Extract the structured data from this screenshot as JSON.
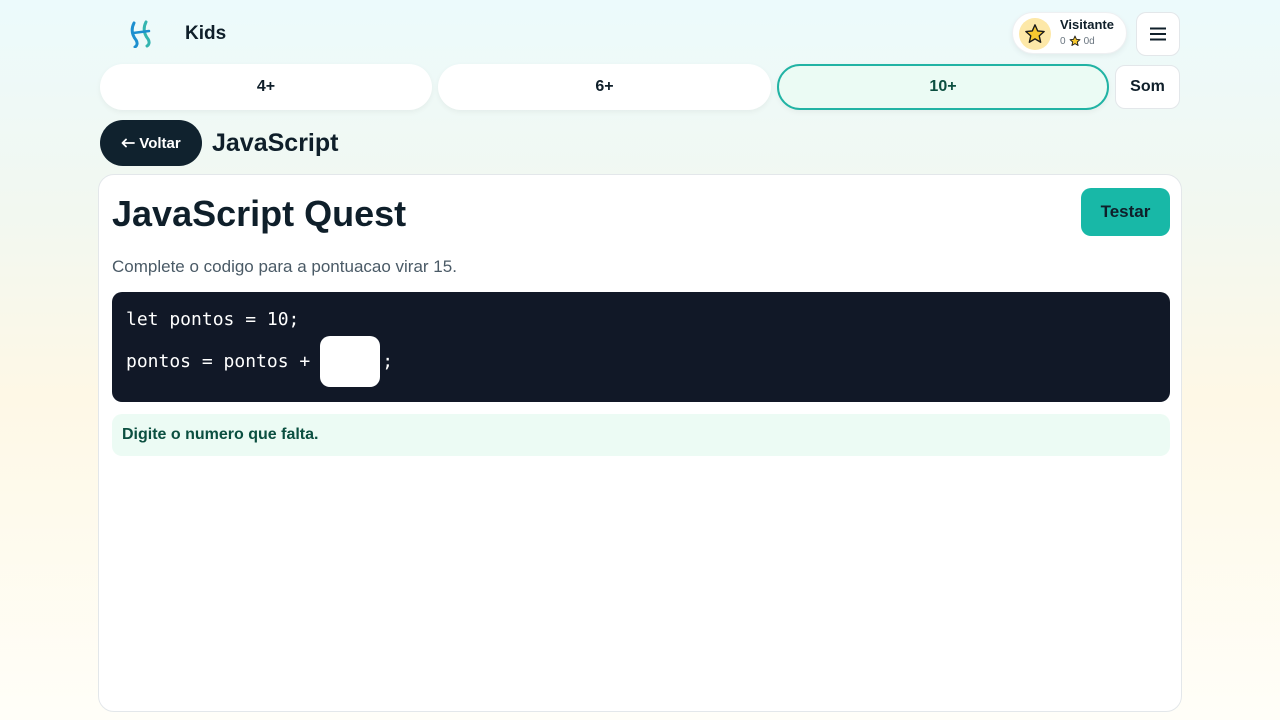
{
  "header": {
    "brand": "Kids",
    "profile": {
      "name": "Visitante",
      "points": "0",
      "days": "0d"
    },
    "menu_icon": "hamburger-icon"
  },
  "age_tabs": [
    {
      "label": "4+",
      "active": false
    },
    {
      "label": "6+",
      "active": false
    },
    {
      "label": "10+",
      "active": true
    }
  ],
  "sound_label": "Som",
  "nav": {
    "back_label": "Voltar",
    "section_title": "JavaScript"
  },
  "quest": {
    "title": "JavaScript Quest",
    "test_label": "Testar",
    "instructions": "Complete o codigo para a pontuacao virar 15.",
    "code_line1": "let pontos = 10;",
    "code_line2_prefix": "pontos = pontos +",
    "code_line2_suffix": ";",
    "answer_value": "",
    "hint": "Digite o numero que falta."
  },
  "colors": {
    "accent": "#18b8a7",
    "dark": "#10222e",
    "code_bg": "#111827",
    "hint_bg": "#ecfbf4",
    "hint_text": "#0b4f40"
  }
}
